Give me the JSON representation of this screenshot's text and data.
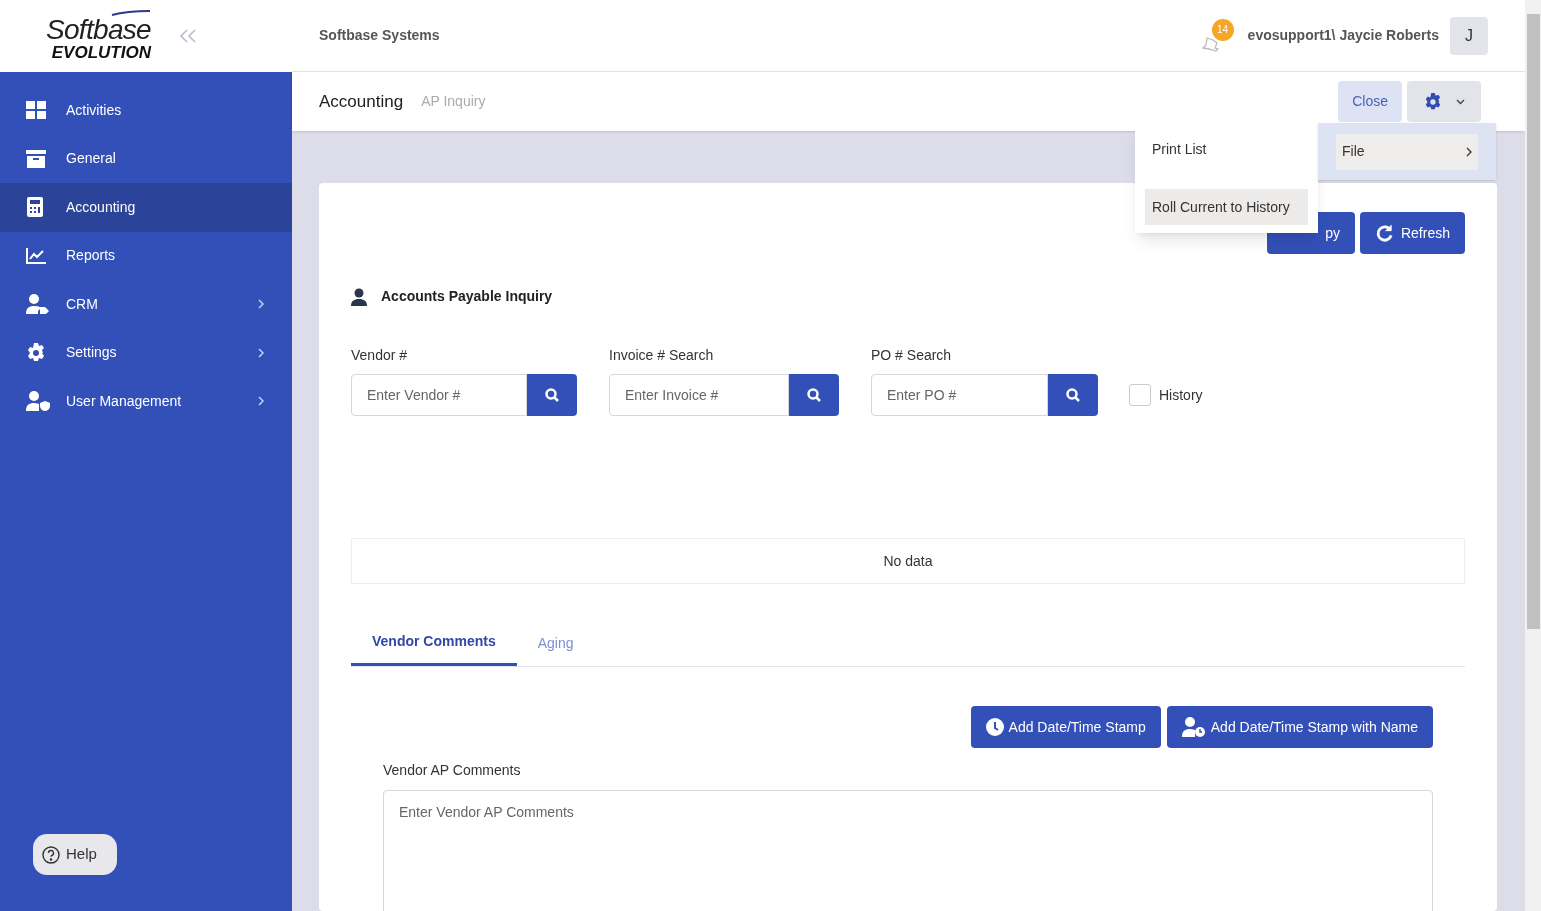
{
  "logo": {
    "line1": "Softbase",
    "line2": "EVOLUTION"
  },
  "sidebar": {
    "items": [
      {
        "label": "Activities",
        "selected": false,
        "has_children": false
      },
      {
        "label": "General",
        "selected": false,
        "has_children": false
      },
      {
        "label": "Accounting",
        "selected": true,
        "has_children": false
      },
      {
        "label": "Reports",
        "selected": false,
        "has_children": false
      },
      {
        "label": "CRM",
        "selected": false,
        "has_children": true
      },
      {
        "label": "Settings",
        "selected": false,
        "has_children": true
      },
      {
        "label": "User Management",
        "selected": false,
        "has_children": true
      }
    ],
    "help": "Help"
  },
  "header": {
    "company": "Softbase Systems",
    "notifications": "14",
    "user": "evosupport1\\ Jaycie Roberts",
    "avatar": "J"
  },
  "breadcrumb": {
    "module": "Accounting",
    "page": "AP Inquiry"
  },
  "actions": {
    "close": "Close"
  },
  "menu": {
    "items": [
      {
        "label": "Print List",
        "selected": false
      },
      {
        "label": "Roll Current to History",
        "selected": true
      }
    ],
    "submenu": {
      "label": "File"
    }
  },
  "toolbar": {
    "copy": "py",
    "refresh": "Refresh"
  },
  "section_title": "Accounts Payable Inquiry",
  "search_fields": [
    {
      "label": "Vendor #",
      "placeholder": "Enter Vendor #"
    },
    {
      "label": "Invoice # Search",
      "placeholder": "Enter Invoice #"
    },
    {
      "label": "PO # Search",
      "placeholder": "Enter PO #"
    }
  ],
  "history": {
    "label": "History",
    "checked": false
  },
  "table": {
    "empty": "No data"
  },
  "tabs": [
    {
      "label": "Vendor Comments",
      "selected": true
    },
    {
      "label": "Aging",
      "selected": false
    }
  ],
  "stamp_buttons": [
    {
      "label": "Add Date/Time Stamp"
    },
    {
      "label": "Add Date/Time Stamp with Name"
    }
  ],
  "comments": {
    "label": "Vendor AP Comments",
    "placeholder": "Enter Vendor AP Comments"
  }
}
